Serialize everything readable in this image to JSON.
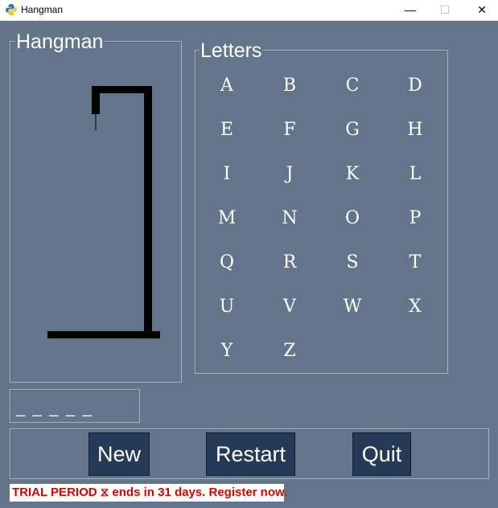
{
  "window": {
    "title": "Hangman",
    "controls": {
      "minimize": "—",
      "maximize": "☐",
      "close": "✕"
    }
  },
  "hangman_panel": {
    "label": "Hangman"
  },
  "letters_panel": {
    "label": "Letters",
    "letters": [
      "A",
      "B",
      "C",
      "D",
      "E",
      "F",
      "G",
      "H",
      "I",
      "J",
      "K",
      "L",
      "M",
      "N",
      "O",
      "P",
      "Q",
      "R",
      "S",
      "T",
      "U",
      "V",
      "W",
      "X",
      "Y",
      "Z"
    ]
  },
  "word_display": "_ _ _ _ _",
  "buttons": {
    "new": "New",
    "restart": "Restart",
    "quit": "Quit"
  },
  "trial_notice": "TRIAL PERIOD ⧖ ends in 31 days. Register now.",
  "colors": {
    "background": "#64748a",
    "button": "#243a57",
    "trial_text": "#e00000"
  }
}
